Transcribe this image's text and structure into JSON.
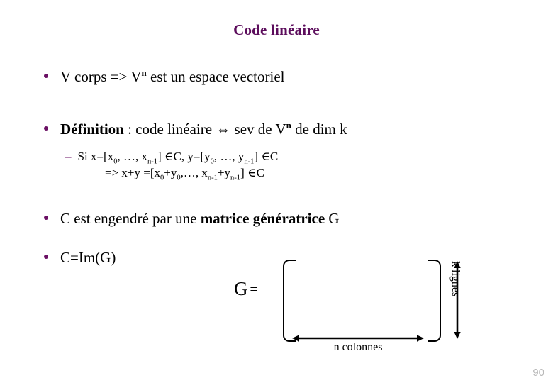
{
  "slide": {
    "title": "Code linéaire",
    "title_color": "#5c0d5c",
    "bullet_color": "#6b1064",
    "page_number": "90"
  },
  "bullets": [
    {
      "id": "vector-space",
      "parts": [
        {
          "text": "V corps => V",
          "style": "normal"
        },
        {
          "text": "n",
          "style": "sup-bold"
        },
        {
          "text": " est un espace vectoriel",
          "style": "normal"
        }
      ],
      "plain": "V corps => Vn est un espace vectoriel"
    },
    {
      "id": "definition",
      "parts": [
        {
          "text": "Définition",
          "style": "bold"
        },
        {
          "text": " : code linéaire ",
          "style": "normal"
        },
        {
          "text": "⇔",
          "style": "normal"
        },
        {
          "text": " sev de V",
          "style": "normal"
        },
        {
          "text": "n",
          "style": "sup-bold"
        },
        {
          "text": " de dim k",
          "style": "normal"
        }
      ],
      "plain": "Définition : code linéaire ⇔ sev de Vn de dim k"
    },
    {
      "id": "generator-matrix",
      "parts": [
        {
          "text": "C est engendré par une ",
          "style": "normal"
        },
        {
          "text": "matrice génératrice",
          "style": "bold"
        },
        {
          "text": " G",
          "style": "normal"
        }
      ],
      "plain": "C est engendré par une matrice génératrice G"
    },
    {
      "id": "image-of-g",
      "parts": [
        {
          "text": "C=Im(G)",
          "style": "normal"
        }
      ],
      "plain": "C=Im(G)"
    }
  ],
  "sublines": {
    "dash": "–",
    "line1_plain": "Si x=[x0, …, x n-1] ∈C, y=[y0, …, y n-1] ∈C",
    "line2_plain": "=> x+y =[x0+y0,…, x n-1+y n-1] ∈C"
  },
  "matrix": {
    "label": "G",
    "equals": "=",
    "rows_label": "k lignes",
    "cols_label": "n colonnes",
    "bracket_open": "[",
    "bracket_close": "]"
  }
}
